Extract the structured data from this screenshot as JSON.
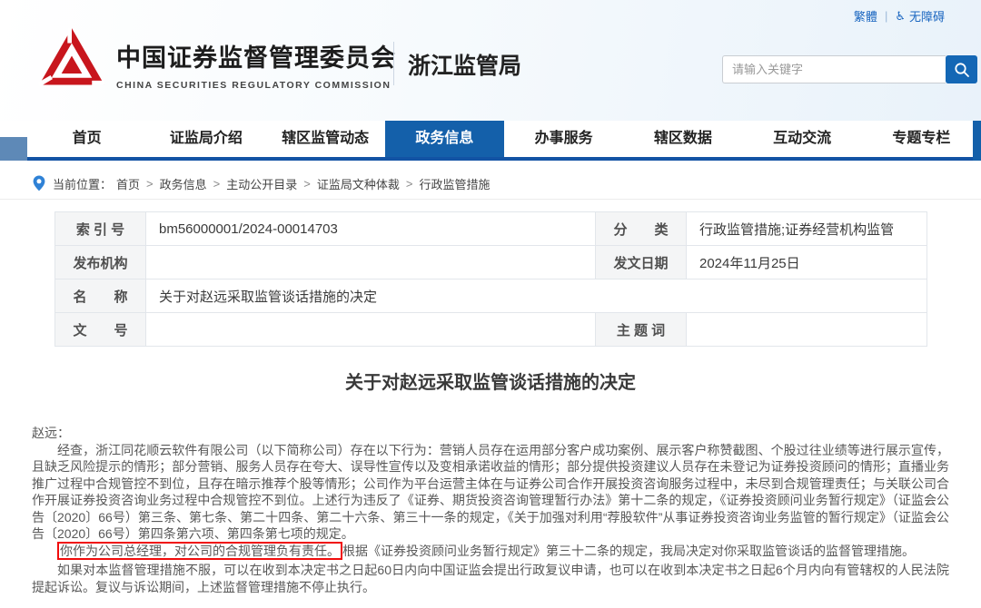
{
  "topbar": {
    "traditional": "繁體",
    "divider": "|",
    "accessibility": "无障碍"
  },
  "header": {
    "org_cn": "中国证券监督管理委员会",
    "org_en": "CHINA SECURITIES REGULATORY COMMISSION",
    "bureau": "浙江监管局",
    "search": {
      "placeholder": "请输入关键字"
    }
  },
  "nav": {
    "items": [
      {
        "label": "首页",
        "active": false
      },
      {
        "label": "证监局介绍",
        "active": false
      },
      {
        "label": "辖区监管动态",
        "active": false
      },
      {
        "label": "政务信息",
        "active": true
      },
      {
        "label": "办事服务",
        "active": false
      },
      {
        "label": "辖区数据",
        "active": false
      },
      {
        "label": "互动交流",
        "active": false
      },
      {
        "label": "专题专栏",
        "active": false
      }
    ]
  },
  "breadcrumb": {
    "prefix": "当前位置：",
    "separator": ">",
    "items": [
      "首页",
      "政务信息",
      "主动公开目录",
      "证监局文种体裁",
      "行政监管措施"
    ]
  },
  "meta_table": {
    "index_label": "索 引 号",
    "index_value": "bm56000001/2024-00014703",
    "category_label": "分　　类",
    "category_value": "行政监管措施;证券经营机构监管",
    "publisher_label": "发布机构",
    "publisher_value": "",
    "date_label": "发文日期",
    "date_value": "2024年11月25日",
    "name_label": "名　　称",
    "name_value": "关于对赵远采取监管谈话措施的决定",
    "docno_label": "文　　号",
    "docno_value": "",
    "subject_label": "主 题 词",
    "subject_value": ""
  },
  "document": {
    "title": "关于对赵远采取监管谈话措施的决定",
    "salutation": "赵远：",
    "para_findings": "经查，浙江同花顺云软件有限公司（以下简称公司）存在以下行为：营销人员存在运用部分客户成功案例、展示客户称赞截图、个股过往业绩等进行展示宣传，且缺乏风险提示的情形；部分营销、服务人员存在夸大、误导性宣传以及变相承诺收益的情形；部分提供投资建议人员存在未登记为证券投资顾问的情形；直播业务推广过程中合规管控不到位，且存在暗示推荐个股等情形；公司作为平台运营主体在与证券公司合作开展投资咨询服务过程中，未尽到合规管理责任；与关联公司合作开展证券投资咨询业务过程中合规管控不到位。上述行为违反了《证券、期货投资咨询管理暂行办法》第十二条的规定，《证券投资顾问业务暂行规定》（证监会公告〔2020〕66号）第三条、第七条、第二十四条、第二十六条、第三十一条的规定，《关于加强对利用“荐股软件”从事证券投资咨询业务监管的暂行规定》（证监会公告〔2020〕66号）第四条第六项、第四条第七项的规定。",
    "para_decision_boxed": "你作为公司总经理，对公司的合规管理负有责任。",
    "para_decision_rest": "根据《证券投资顾问业务暂行规定》第三十二条的规定，我局决定对你采取监管谈话的监督管理措施。",
    "para_appeal": "如果对本监督管理措施不服，可以在收到本决定书之日起60日内向中国证监会提出行政复议申请，也可以在收到本决定书之日起6个月内向有管辖权的人民法院提起诉讼。复议与诉讼期间，上述监督管理措施不停止执行。"
  },
  "colors": {
    "primary_blue": "#1460aa",
    "nav_border_blue": "#1253a4",
    "link_blue": "#1a66c0",
    "logo_red": "#c8161d",
    "highlight_red": "#f00c0c",
    "label_bg": "#f4f5f6"
  }
}
